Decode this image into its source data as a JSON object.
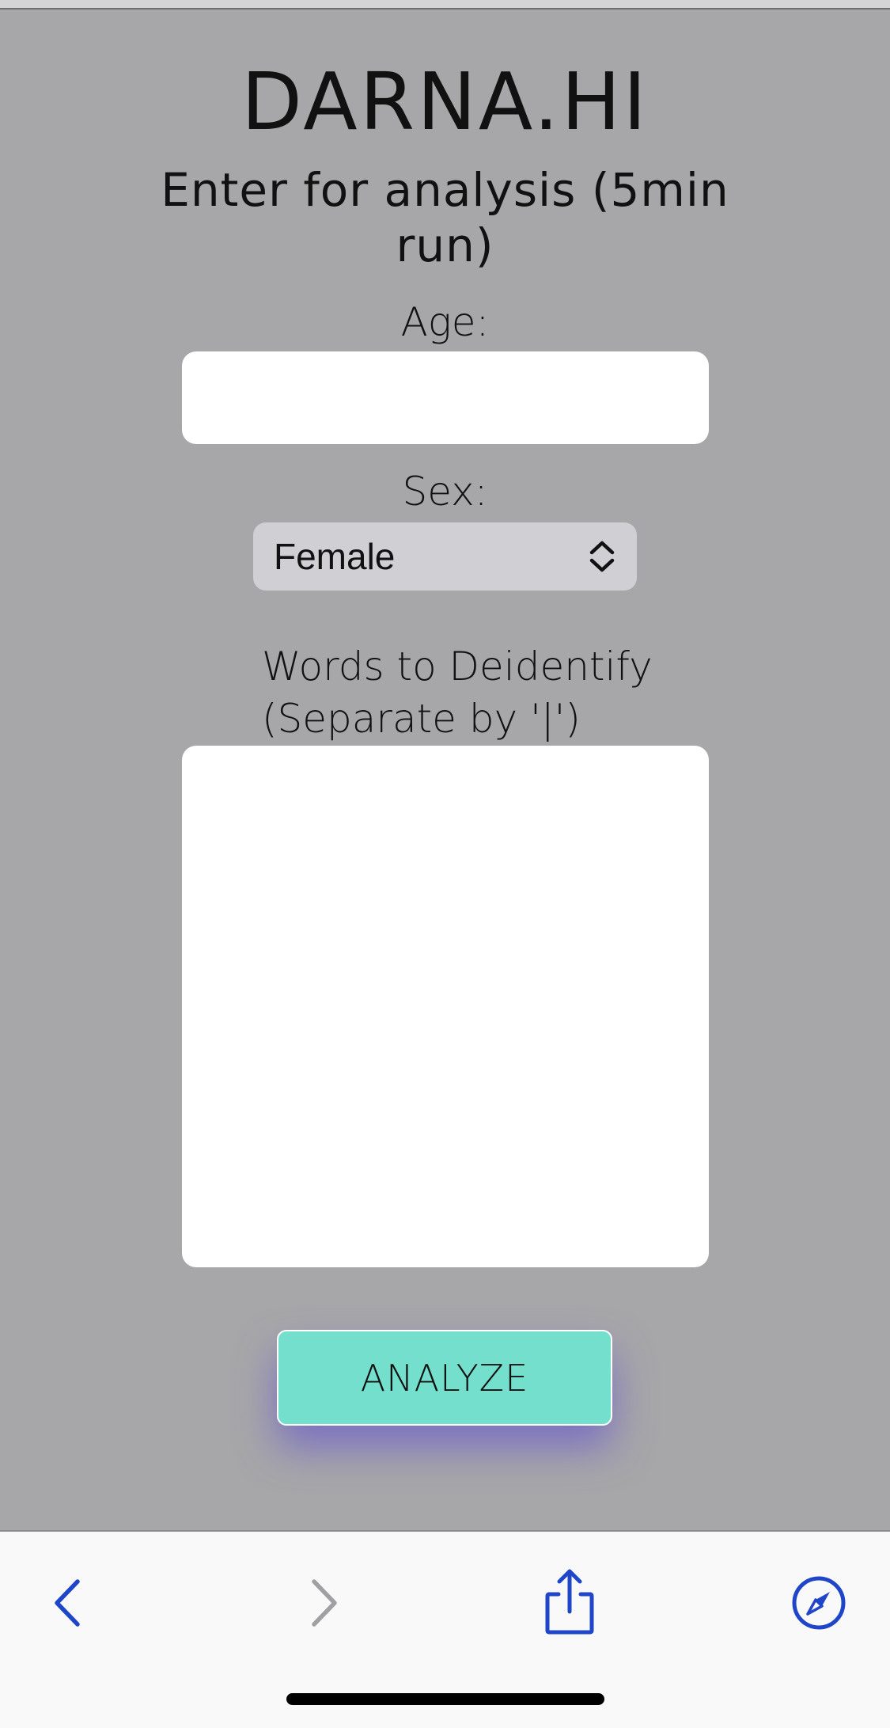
{
  "app": {
    "title": "DARNA.HI",
    "subtitle": "Enter for analysis (5min run)"
  },
  "form": {
    "age": {
      "label": "Age:",
      "value": "",
      "placeholder": ""
    },
    "sex": {
      "label": "Sex:",
      "selected": "Female"
    },
    "words": {
      "label_line1": "Words to Deidentify",
      "label_line2": "(Separate by '|')",
      "value": ""
    },
    "analyze_label": "ANALYZE"
  },
  "colors": {
    "page_background": "#a7a7a9",
    "button": "#74dfcd",
    "button_glow": "#6e5fc8",
    "toolbar_icons": "#1f45c9",
    "toolbar_disabled": "#a0a0a2"
  },
  "toolbar": {
    "icons": [
      "back-chevron-icon",
      "forward-chevron-icon",
      "share-icon",
      "safari-compass-icon"
    ]
  }
}
